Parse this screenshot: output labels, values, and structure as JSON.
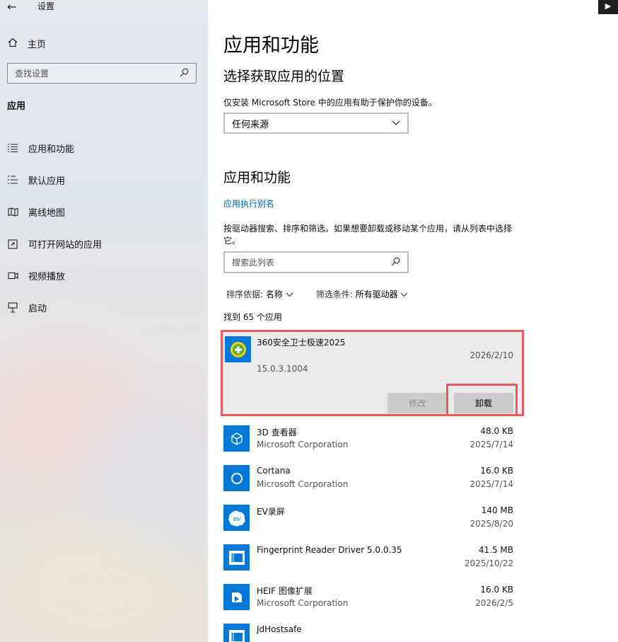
{
  "window": {
    "title": "设置",
    "corner": "▶"
  },
  "sidebar": {
    "home": "主页",
    "search_placeholder": "查找设置",
    "section": "应用",
    "items": [
      {
        "label": "应用和功能",
        "icon": "list-icon"
      },
      {
        "label": "默认应用",
        "icon": "default-apps-icon"
      },
      {
        "label": "离线地图",
        "icon": "map-icon"
      },
      {
        "label": "可打开网站的应用",
        "icon": "open-web-icon"
      },
      {
        "label": "视频播放",
        "icon": "video-icon"
      },
      {
        "label": "启动",
        "icon": "startup-icon"
      }
    ]
  },
  "main": {
    "page_title": "应用和功能",
    "source_heading": "选择获取应用的位置",
    "source_desc": "仅安装 Microsoft Store 中的应用有助于保护你的设备。",
    "source_value": "任何来源",
    "apps_heading": "应用和功能",
    "alias_link": "应用执行别名",
    "apps_desc": "按驱动器搜索、排序和筛选。如果想要卸载或移动某个应用，请从列表中选择它。",
    "list_search_placeholder": "搜索此列表",
    "sort_label": "排序依据:",
    "sort_value": "名称",
    "filter_label": "筛选条件:",
    "filter_value": "所有驱动器",
    "count_text": "找到 65 个应用",
    "selected_app": {
      "name": "360安全卫士极速2025",
      "date": "2026/2/10",
      "version": "15.0.3.1004",
      "modify_label": "修改",
      "uninstall_label": "卸载"
    },
    "apps": [
      {
        "name": "3D 查看器",
        "publisher": "Microsoft Corporation",
        "size": "48.0 KB",
        "date": "2025/7/14"
      },
      {
        "name": "Cortana",
        "publisher": "Microsoft Corporation",
        "size": "16.0 KB",
        "date": "2025/7/14"
      },
      {
        "name": "EV录屏",
        "publisher": "",
        "size": "140 MB",
        "date": "2025/8/20"
      },
      {
        "name": "Fingerprint Reader Driver 5.0.0.35",
        "publisher": "",
        "size": "41.5 MB",
        "date": "2025/10/22"
      },
      {
        "name": "HEIF 图像扩展",
        "publisher": "Microsoft Corporation",
        "size": "16.0 KB",
        "date": "2026/2/5"
      },
      {
        "name": "JdHostsafe",
        "publisher": "",
        "size": "",
        "date": ""
      }
    ]
  }
}
